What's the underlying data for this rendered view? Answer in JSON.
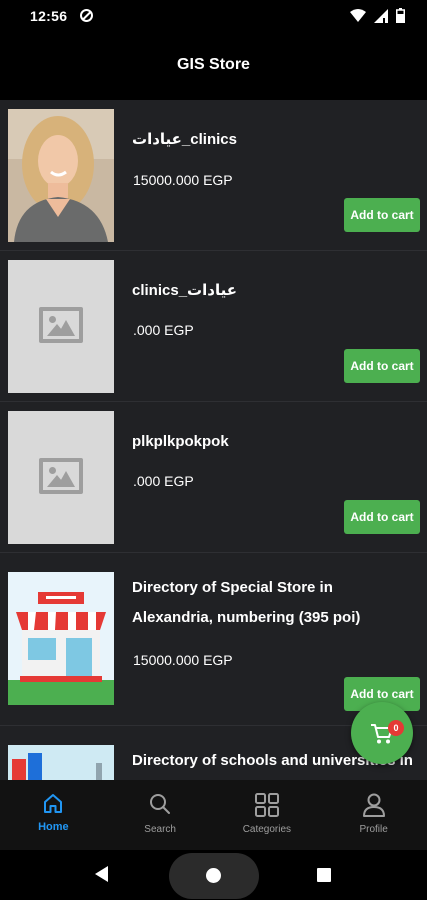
{
  "status": {
    "time": "12:56"
  },
  "app": {
    "title": "GIS Store"
  },
  "products": [
    {
      "name": "عيادات_clinics",
      "price": "15000.000 EGP",
      "image": "woman-photo"
    },
    {
      "name": "clinics_عيادات",
      "price": ".000 EGP",
      "image": "placeholder"
    },
    {
      "name": "plkplkpokpok",
      "price": ".000 EGP",
      "image": "placeholder"
    },
    {
      "name": "Directory of Special Store in Alexandria, numbering (395 poi)",
      "price": "15000.000 EGP",
      "image": "store-illustration"
    },
    {
      "name": "Directory of schools and universities in",
      "price": "",
      "image": "school-illustration"
    }
  ],
  "add_to_cart_label": "Add to cart",
  "cart": {
    "count": "0"
  },
  "bottom_nav": [
    {
      "label": "Home",
      "icon": "home-icon",
      "active": true
    },
    {
      "label": "Search",
      "icon": "search-icon"
    },
    {
      "label": "Categories",
      "icon": "categories-icon"
    },
    {
      "label": "Profile",
      "icon": "profile-icon"
    }
  ],
  "colors": {
    "accent": "#4caf50",
    "active_tab": "#2196f3",
    "badge": "#e53935",
    "card_bg": "#202124"
  }
}
